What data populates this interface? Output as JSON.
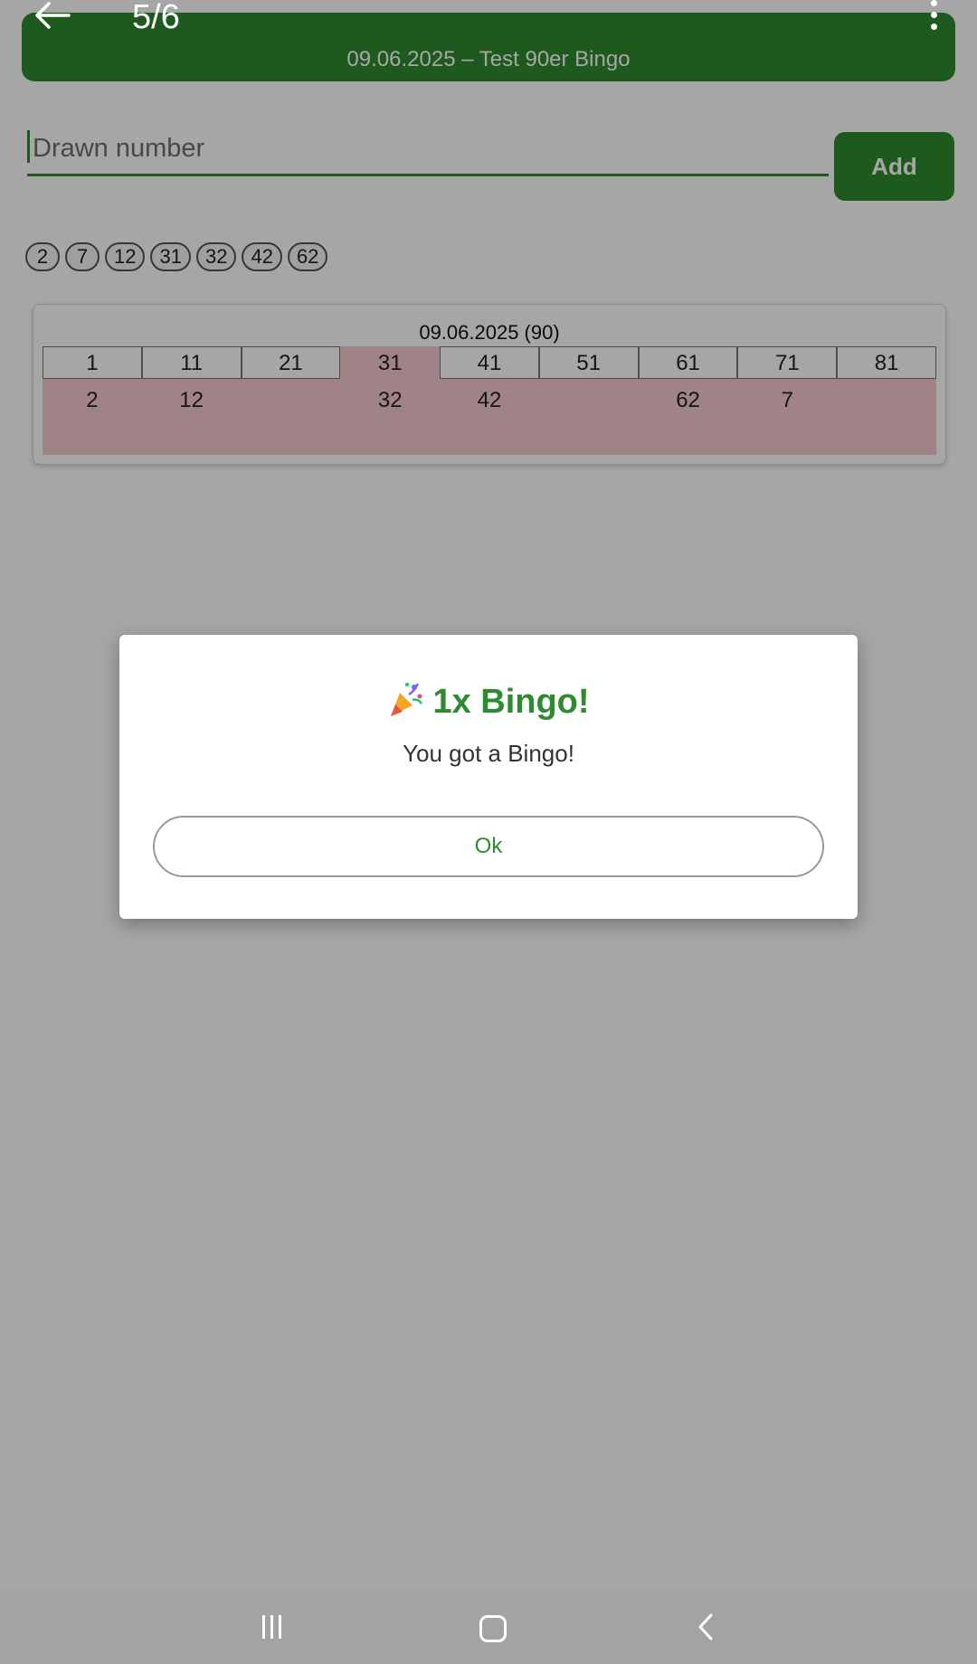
{
  "viewer": {
    "counter": "5/6"
  },
  "header": {
    "title": "09.06.2025 – Test 90er Bingo",
    "color": "#2e8b2f"
  },
  "input": {
    "placeholder": "Drawn number",
    "value": ""
  },
  "add_button": {
    "label": "Add"
  },
  "drawn_numbers": [
    "2",
    "7",
    "12",
    "31",
    "32",
    "42",
    "62"
  ],
  "card": {
    "title": "09.06.2025 (90)",
    "header_row": [
      "1",
      "11",
      "21",
      "31",
      "41",
      "51",
      "61",
      "71",
      "81"
    ],
    "value_row": [
      "2",
      "12",
      "",
      "32",
      "42",
      "",
      "62",
      "7",
      ""
    ],
    "highlight_color": "#f6c9cf"
  },
  "dialog": {
    "icon": "party-popper-icon",
    "title": "1x Bingo!",
    "message": "You got a Bingo!",
    "ok_label": "Ok"
  },
  "system_nav": {
    "items": [
      "recents-icon",
      "home-icon",
      "back-icon"
    ]
  }
}
